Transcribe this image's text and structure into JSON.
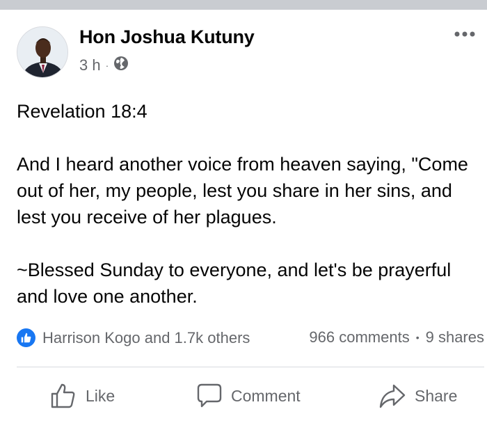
{
  "post": {
    "author": "Hon Joshua Kutuny",
    "time": "3 h",
    "separator": "·",
    "privacy_icon": "globe-icon",
    "paragraphs": [
      "Revelation 18:4",
      "And I heard another voice from heaven saying, \"Come out of her, my people, lest you share in her sins, and lest you receive of her plagues.",
      "~Blessed Sunday to everyone, and let's be prayerful and love one another."
    ]
  },
  "engagement": {
    "reaction_icon": "like-reaction-icon",
    "reactions_text": "Harrison Kogo and 1.7k others",
    "comments": "966 comments",
    "separator": "•",
    "shares": "9 shares"
  },
  "actions": {
    "like": "Like",
    "comment": "Comment",
    "share": "Share"
  },
  "colors": {
    "accent": "#1877f2",
    "secondary_text": "#65676b",
    "divider": "#d8dadf",
    "top_bar": "#c9ccd1"
  }
}
